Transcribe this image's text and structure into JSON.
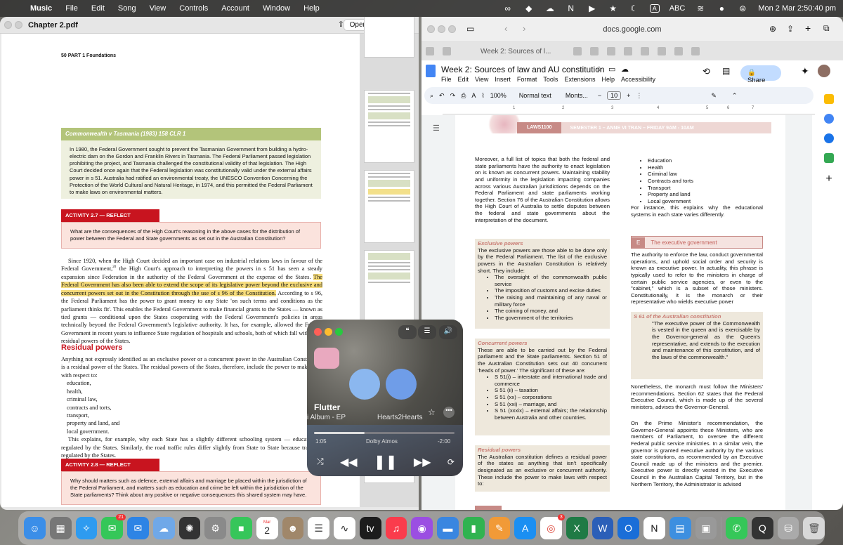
{
  "menubar": {
    "app": "Music",
    "items": [
      "File",
      "Edit",
      "Song",
      "View",
      "Controls",
      "Account",
      "Window",
      "Help"
    ],
    "input": "ABC",
    "clock": "Mon 2 Mar  2:50:40 pm",
    "icons": [
      "apple-icon",
      "creative-cloud-icon",
      "dropbox-icon",
      "cloud-icon",
      "notion-icon",
      "play-circle-icon",
      "star-icon",
      "focus-icon",
      "wifi-icon",
      "siri-icon",
      "control-center-icon"
    ]
  },
  "preview": {
    "title": "Chapter 2.pdf",
    "open_with": "Open with Preview",
    "page_header": "50  PART 1 Foundations",
    "case_heading": "Commonwealth v Tasmania (1983) 158 CLR 1",
    "case_text": "In 1980, the Federal Government sought to prevent the Tasmanian Government from building a hydro-electric dam on the Gordon and Franklin Rivers in Tasmania. The Federal Parliament passed legislation prohibiting the project, and Tasmania challenged the constitutional validity of that legislation. The High Court decided once again that the Federal legislation was constitutionally valid under the external affairs power in s 51. Australia had ratified an environmental treaty, the UNESCO Convention Concerning the Protection of the World Cultural and Natural Heritage, in 1974, and this permitted the Federal Parliament to make laws on environmental matters.",
    "activity1_heading": "ACTIVITY 2.7 — REFLECT",
    "activity1_text": "What are the consequences of the High Court's reasoning in the above cases for the distribution of power between the Federal and State governments as set out in the Australian Constitution?",
    "para1_start": "Since 1920, when the High Court decided an important case on industrial relations laws in favour of the Federal Government,",
    "para1_sup": "20",
    "para1_mid": " the High Court's approach to interpreting the powers in s 51 has seen a steady expansion since Federation in the authority of the Federal Government at the expense of the States. ",
    "para1_hl": "The Federal Government has also been able to extend the scope of its legislative power beyond the exclusive and concurrent powers set out in the Constitution through the use of s 96 of the Constitution.",
    "para1_end": " According to s 96, the Federal Parliament has the power to grant money to any State 'on such terms and conditions as the parliament thinks fit'. This enables the Federal Government to make financial grants to the States — known as tied grants — conditional upon the States cooperating with the Federal Government's policies in areas technically beyond the Federal Government's legislative authority. It has, for example, allowed the Federal Government in recent years to influence State regulation of hospitals and schools, both of which fall within the residual powers of the States.",
    "residual_heading": "Residual powers",
    "residual_text": "Anything not expressly identified as an exclusive power or a concurrent power in the Australian Constitution is a residual power of the States. The residual powers of the States, therefore, include the power to make laws with respect to:",
    "residual_list": [
      "education,",
      "health,",
      "criminal law,",
      "contracts and torts,",
      "transport,",
      "property and land, and",
      "local government."
    ],
    "residual_after": "This explains, for example, why each State has a slightly different schooling system — education is regulated by the States. Similarly, the road traffic rules differ slightly from State to State because traffic is regulated by the States.",
    "activity2_heading": "ACTIVITY 2.8 — REFLECT",
    "activity2_text": "Why should matters such as defence, external affairs and marriage be placed within the jurisdiction of the Federal Parliament, and matters such as education and crime be left within the jurisdiction of the State parliaments? Think about any positive or negative consequences this shared system may have."
  },
  "docs": {
    "url": "docs.google.com",
    "tab_label": "Week 2: Sources of l...",
    "doc_title": "Week 2: Sources of law and AU constitution",
    "menus": [
      "File",
      "Edit",
      "View",
      "Insert",
      "Format",
      "Tools",
      "Extensions",
      "Help",
      "Accessibility"
    ],
    "share": "Share",
    "zoom": "100%",
    "style": "Normal text",
    "font": "Monts...",
    "font_size": "10",
    "ruler": [
      "1",
      "2",
      "3",
      "4",
      "5",
      "6",
      "7"
    ],
    "band_code": "LAWS1100",
    "band_sem": "SEMESTER 1 – ANNE VI TRAN – FRIDAY 9AM - 10AM",
    "left_intro": "Moreover, a full list of topics that both the federal and state parliaments have the authority to enact legislation on is known as concurrent powers. Maintaining stability and uniformity in the legislation impacting companies across various Australian jurisdictions depends on the Federal Parliament and state parliaments working together. Section 76 of the Australian Constitution allows the High Court of Australia to settle disputes between the federal and state governments about the interpretation of the document.",
    "excl_head": "Exclusive powers",
    "excl_text": "The exclusive powers are those able to be done only by the Federal Parliament. The list of the exclusive powers in the Australian Constitution is relatively short. They include:",
    "excl_list": [
      "The oversight of the commonwealth public service",
      "The imposition of customs and excise duties",
      "The raising and maintaining of any naval or military force",
      "The coining of money, and",
      "The government of the territories"
    ],
    "conc_head": "Concurrent powers",
    "conc_text": "These are able to be carried out by the Federal parliament and the State parliaments. Section 51 of the Australian Constitution sets out 40 concurrent 'heads of power.' The significant of these are:",
    "conc_list": [
      "S 51(i) – interstate and international trade and commerce",
      "S 51 (ii) – taxation",
      "S 51 (xx) – corporations",
      "S 51 (xxi) – marriage, and",
      "S 51 (xxxix) – external affairs; the relationship between Australia and other countries."
    ],
    "resid_head": "Residual powers",
    "resid_text": "The Australian constitution defines a residual power of the states as anything that isn't specifically designated as an exclusive or concurrent authority. These include the power to make laws with respect to:",
    "right_list": [
      "Education",
      "Health",
      "Criminal law",
      "Contracts and torts",
      "Transport",
      "Property and land",
      "Local government"
    ],
    "right_text1": "For instance, this explains why the educational systems in each state varies differently.",
    "exec_letter": "E",
    "exec_head": "The executive government",
    "exec_text": "The authority to enforce the law, conduct governmental operations, and uphold social order and security is known as executive power. In actuality, this phrase is typically used to refer to the ministers in charge of certain public service agencies, or even to the \"cabinet,\" which is a subset of those ministers. Constitutionally, it is the monarch or their representative who wields executive power",
    "s61_head": "S 61 of the Australian constitution",
    "s61_quote": "\"The executive power of the Commonwealth is vested in the queen and is exercisable by the Governor-general as the Queen's representative, and extends to the execution and maintenance of this constitution, and of the laws of the commonwealth.\"",
    "right_text2": "Nonetheless, the monarch must follow the Ministers' recommendations. Section 62 states that the Federal Executive Council, which is made up of the several ministers, advises the Governor-General.",
    "right_text3": "On the Prime Minister's recommendation, the Governor-General appoints these Ministers, who are members of Parliament, to oversee the different Federal public service ministries. In a similar vein, the governor is granted executive authority by the various state constitutions, as recommended by an Executive Council made up of the ministers and the premier. Executive power is directly vested in the Executive Council in the Australian Capital Territory, but in the Northern Territory, the Administrator is advised"
  },
  "music": {
    "title": "Flutter",
    "album": "i Album - EP",
    "artist": "Hearts2Hearts",
    "elapsed": "1:05",
    "remaining": "-2:00",
    "dolby": "Dolby Atmos",
    "progress": 0.36
  },
  "dock": {
    "apps": [
      "finder",
      "launchpad",
      "safari",
      "messages",
      "mail",
      "icloud",
      "chatgpt",
      "settings",
      "facetime",
      "calendar",
      "contacts",
      "reminders",
      "freeform",
      "tv",
      "music",
      "podcasts",
      "keynote",
      "numbers",
      "pages",
      "appstore",
      "chrome",
      "excel",
      "word",
      "outlook",
      "notion",
      "files",
      "preview",
      "phone",
      "quicktime",
      "disk-utility",
      "trash"
    ],
    "calendar_month": "Mar",
    "calendar_day": "2",
    "messages_badge": "21",
    "chrome_badge": "3"
  }
}
